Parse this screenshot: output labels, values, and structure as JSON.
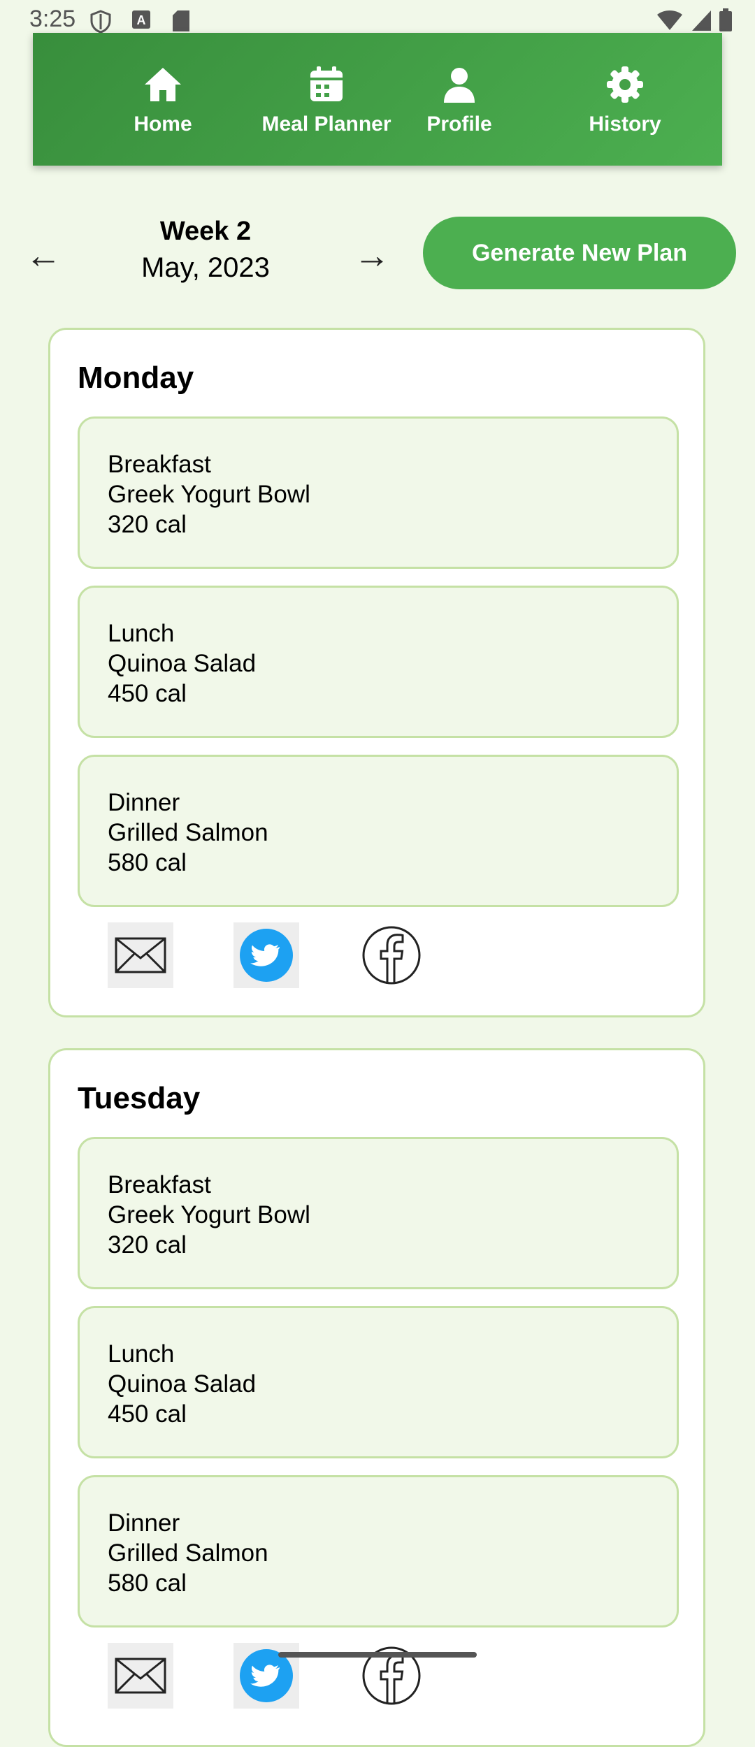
{
  "status_bar": {
    "time": "3:25"
  },
  "nav": {
    "items": [
      {
        "label": "Home",
        "icon": "home-icon"
      },
      {
        "label": "Meal Planner",
        "icon": "calendar-icon"
      },
      {
        "label": "Profile",
        "icon": "person-icon"
      },
      {
        "label": "History",
        "icon": "gear-icon"
      }
    ]
  },
  "week_nav": {
    "prev": "←",
    "next": "→",
    "title": "Week 2",
    "subtitle": "May, 2023",
    "generate_label": "Generate New Plan"
  },
  "days": [
    {
      "name": "Monday",
      "meals": [
        {
          "type": "Breakfast",
          "dish": "Greek Yogurt Bowl",
          "calories": "320 cal"
        },
        {
          "type": "Lunch",
          "dish": "Quinoa Salad",
          "calories": "450 cal"
        },
        {
          "type": "Dinner",
          "dish": "Grilled Salmon",
          "calories": "580 cal"
        }
      ],
      "share": [
        "email-icon",
        "twitter-icon",
        "facebook-icon"
      ]
    },
    {
      "name": "Tuesday",
      "meals": [
        {
          "type": "Breakfast",
          "dish": "Greek Yogurt Bowl",
          "calories": "320 cal"
        },
        {
          "type": "Lunch",
          "dish": "Quinoa Salad",
          "calories": "450 cal"
        },
        {
          "type": "Dinner",
          "dish": "Grilled Salmon",
          "calories": "580 cal"
        }
      ],
      "share": [
        "email-icon",
        "twitter-icon",
        "facebook-icon"
      ]
    }
  ],
  "colors": {
    "primary": "#4caf50",
    "primary_dark": "#388e3c",
    "background": "#f1f8e9",
    "border": "#c5e1a5",
    "twitter": "#1da1f2"
  }
}
